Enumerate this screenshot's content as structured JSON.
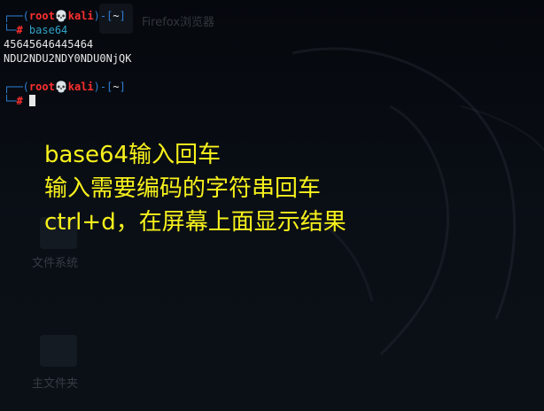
{
  "desktop": {
    "icons": [
      {
        "name": "browser",
        "label": "Firefox浏览器"
      },
      {
        "name": "filesystem",
        "label": "文件系统"
      },
      {
        "name": "home",
        "label": "主文件夹"
      }
    ]
  },
  "terminal": {
    "prompt": {
      "open": "┌──(",
      "user": "root",
      "skull": "💀",
      "host": "kali",
      "mid": ")-[",
      "dir": "~",
      "close": "]",
      "second_line": "└─",
      "symbol": "#"
    },
    "commands": [
      {
        "command": "base64",
        "output": [
          "45645646445464",
          "NDU2NDU2NDY0NDU0NjQK"
        ]
      }
    ]
  },
  "annotation": {
    "lines": [
      "base64输入回车",
      "输入需要编码的字符串回车",
      "ctrl+d，在屏幕上面显示结果"
    ],
    "color": "#f7f11c"
  },
  "colors": {
    "prompt_frame": "#2f7fd6",
    "prompt_user": "#ff2f2f",
    "command": "#2fa3c7",
    "background": "#05080d"
  }
}
